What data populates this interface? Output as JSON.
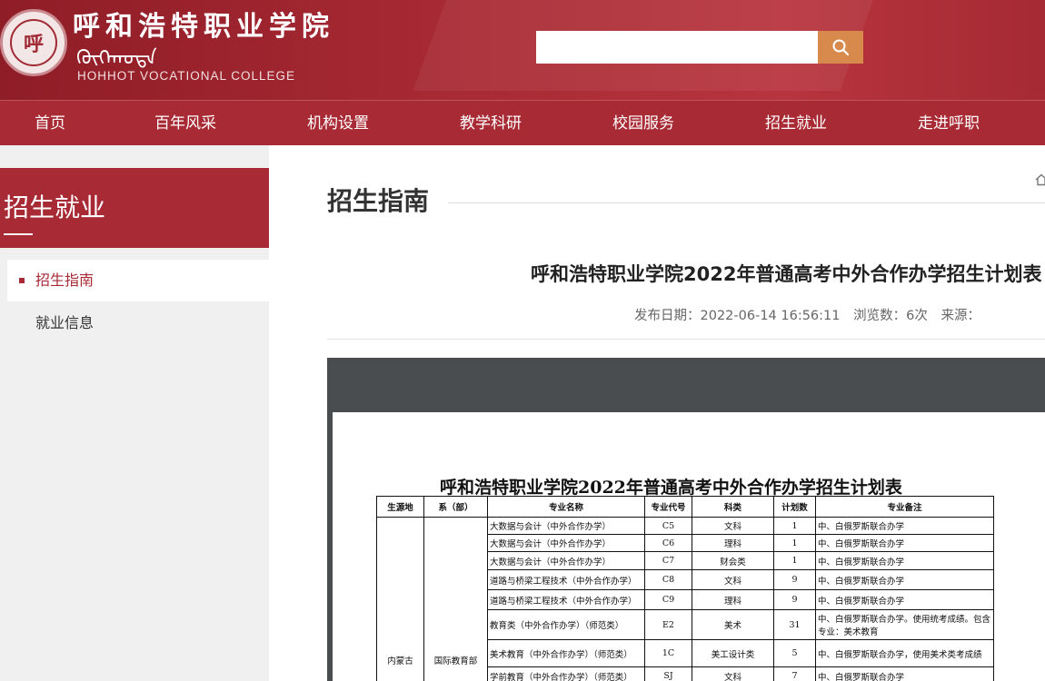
{
  "header": {
    "seal_text": "呼",
    "college_name_cn": "呼和浩特职业学院",
    "college_name_mongol": "ᠬᠥᠬᠡᠬᠣᠲᠠ",
    "college_name_en": "HOHHOT VOCATIONAL COLLEGE",
    "search_placeholder": ""
  },
  "nav": {
    "items": [
      "首页",
      "百年风采",
      "机构设置",
      "教学科研",
      "校园服务",
      "招生就业",
      "走进呼职"
    ]
  },
  "sidebar": {
    "title": "招生就业",
    "items": [
      {
        "label": "招生指南",
        "active": true
      },
      {
        "label": "就业信息",
        "active": false
      }
    ]
  },
  "main": {
    "section_title": "招生指南",
    "article_title": "呼和浩特职业学院2022年普通高考中外合作办学招生计划表",
    "meta": {
      "publish_date": "发布日期：2022-06-14 16:56:11",
      "views": "浏览数：6次",
      "source": "来源："
    }
  },
  "document": {
    "title": "呼和浩特职业学院2022年普通高考中外合作办学招生计划表",
    "columns": [
      "生源地",
      "系（部）",
      "专业名称",
      "专业代号",
      "科类",
      "计划数",
      "专业备注"
    ],
    "region": "内蒙古",
    "department": "国际教育部",
    "rows": [
      {
        "major": "大数据与会计（中外合作办学）",
        "code": "C5",
        "category": "文科",
        "plan": "1",
        "note": "中、白俄罗斯联合办学"
      },
      {
        "major": "大数据与会计（中外合作办学）",
        "code": "C6",
        "category": "理科",
        "plan": "1",
        "note": "中、白俄罗斯联合办学"
      },
      {
        "major": "大数据与会计（中外合作办学）",
        "code": "C7",
        "category": "财会类",
        "plan": "1",
        "note": "中、白俄罗斯联合办学"
      },
      {
        "major": "道路与桥梁工程技术（中外合作办学）",
        "code": "C8",
        "category": "文科",
        "plan": "9",
        "note": "中、白俄罗斯联合办学"
      },
      {
        "major": "道路与桥梁工程技术（中外合作办学）",
        "code": "C9",
        "category": "理科",
        "plan": "9",
        "note": "中、白俄罗斯联合办学"
      },
      {
        "major": "教育类（中外合作办学）（师范类）",
        "code": "E2",
        "category": "美术",
        "plan": "31",
        "note": "中、白俄罗斯联合办学。使用统考成绩。包含专业：美术教育"
      },
      {
        "major": "美术教育（中外合作办学）（师范类）",
        "code": "1C",
        "category": "美工设计类",
        "plan": "5",
        "note": "中、白俄罗斯联合办学，使用美术类考成绩"
      },
      {
        "major": "学前教育（中外合作办学）（师范类）",
        "code": "SJ",
        "category": "文科",
        "plan": "7",
        "note": "中、白俄罗斯联合办学"
      }
    ]
  },
  "colors": {
    "brand": "#a82a34",
    "search_button": "#d88a4d"
  },
  "icons": {
    "search": "search-icon",
    "home": "home-icon"
  }
}
